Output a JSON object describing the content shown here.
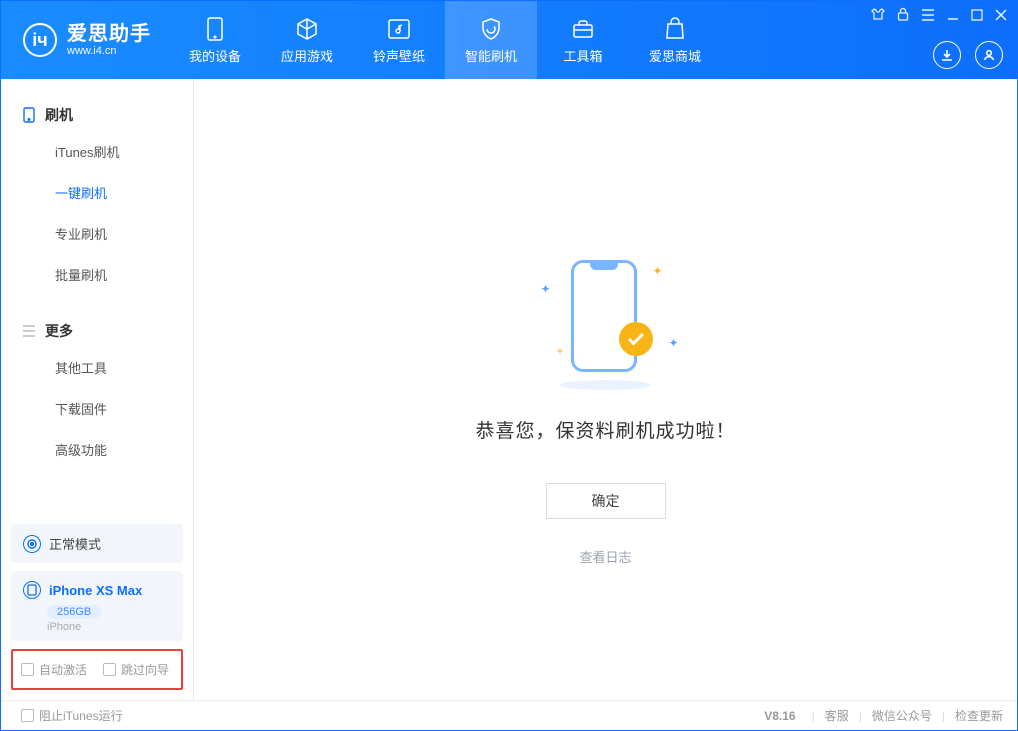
{
  "brand": {
    "title": "爱思助手",
    "subtitle": "www.i4.cn"
  },
  "nav": {
    "items": [
      {
        "label": "我的设备"
      },
      {
        "label": "应用游戏"
      },
      {
        "label": "铃声壁纸"
      },
      {
        "label": "智能刷机"
      },
      {
        "label": "工具箱"
      },
      {
        "label": "爱思商城"
      }
    ]
  },
  "sidebar": {
    "group1": {
      "title": "刷机",
      "items": [
        "iTunes刷机",
        "一键刷机",
        "专业刷机",
        "批量刷机"
      ]
    },
    "group2": {
      "title": "更多",
      "items": [
        "其他工具",
        "下载固件",
        "高级功能"
      ]
    },
    "mode": {
      "label": "正常模式"
    },
    "device": {
      "name": "iPhone XS Max",
      "storage": "256GB",
      "type": "iPhone"
    },
    "opts": {
      "a": "自动激活",
      "b": "跳过向导"
    }
  },
  "main": {
    "message": "恭喜您，保资料刷机成功啦！",
    "ok": "确定",
    "log": "查看日志"
  },
  "footer": {
    "block_itunes": "阻止iTunes运行",
    "version": "V8.16",
    "links": [
      "客服",
      "微信公众号",
      "检查更新"
    ]
  }
}
